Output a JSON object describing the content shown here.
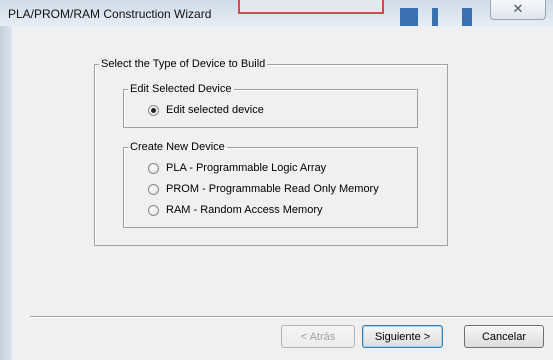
{
  "window": {
    "title": "PLA/PROM/RAM Construction Wizard",
    "close_glyph": "✕"
  },
  "main_group": {
    "legend": "Select the Type of Device to Build"
  },
  "edit_group": {
    "legend": "Edit Selected Device",
    "options": [
      {
        "label": "Edit selected device",
        "checked": true
      }
    ]
  },
  "create_group": {
    "legend": "Create New Device",
    "options": [
      {
        "label": "PLA - Programmable Logic Array",
        "checked": false
      },
      {
        "label": "PROM - Programmable Read Only Memory",
        "checked": false
      },
      {
        "label": "RAM - Random Access Memory",
        "checked": false
      }
    ]
  },
  "buttons": {
    "back": "< Atrás",
    "next": "Siguiente >",
    "cancel": "Cancelar"
  }
}
